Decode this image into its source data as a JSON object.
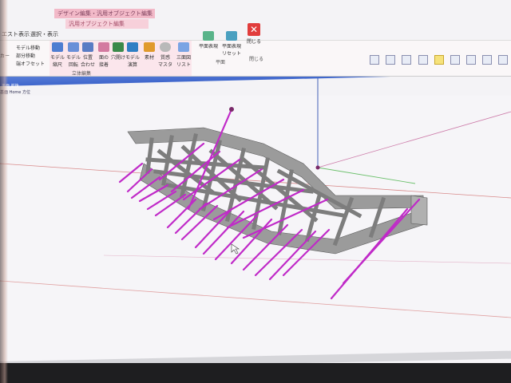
{
  "ribbon": {
    "context_tab_1": "デザイン編集・汎用オブジェクト編集",
    "context_tab_2": "汎用オブジェクト編集",
    "tabs": [
      "エスト表示",
      "選択・表示"
    ],
    "buttons": [
      {
        "label": "モデル移動",
        "icon": "move-icon"
      },
      {
        "label": "部分移動",
        "icon": "partial-move-icon"
      },
      {
        "label": "端オフセット",
        "icon": "offset-icon"
      },
      {
        "label": "モデル\n縮尺",
        "icon": "scale-icon"
      },
      {
        "label": "モデル\n回転",
        "icon": "rotate-icon"
      },
      {
        "label": "位置\n合わせ",
        "icon": "align-icon"
      },
      {
        "label": "面の\n接着",
        "icon": "glue-icon"
      },
      {
        "label": "穴開け",
        "icon": "hole-icon"
      },
      {
        "label": "モデル\n演算",
        "icon": "boolean-icon"
      },
      {
        "label": "素材",
        "icon": "material-icon"
      },
      {
        "label": "質感\nマスタ",
        "icon": "texture-icon"
      },
      {
        "label": "三面図\nリスト",
        "icon": "three-view-icon"
      },
      {
        "label": "平面表現",
        "icon": "plane-icon"
      },
      {
        "label": "平面表現\nリセット",
        "icon": "plane-reset-icon"
      },
      {
        "label": "閉じる",
        "icon": "close-icon"
      }
    ],
    "group_labels": [
      "立体編集",
      "平面",
      "閉じる"
    ],
    "left_clip": "カー"
  },
  "breadcrumb": "基面 Home 方位",
  "viewport_tab": "平面 前後",
  "colors": {
    "accent_blue": "#4a6fd4",
    "ribbon_pink": "#fbe6ec",
    "frame_gray": "#8c8c8c",
    "ray_magenta": "#c02ac8",
    "axis_red": "#d07070",
    "axis_green": "#6cc06c",
    "axis_blue": "#3050b0"
  }
}
